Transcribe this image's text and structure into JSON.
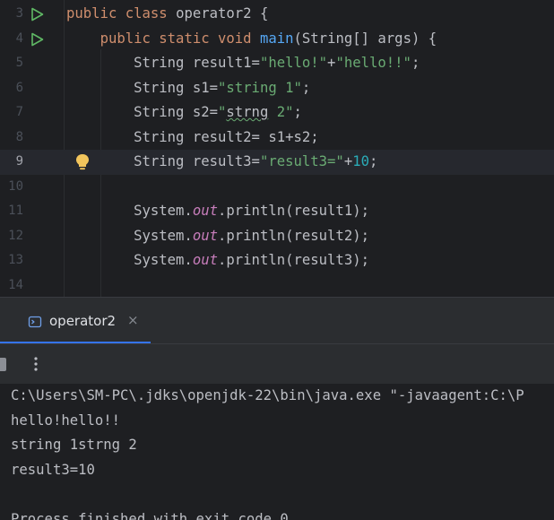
{
  "editor": {
    "lines": [
      {
        "no": "3",
        "tokens": [
          [
            "kw",
            "public class "
          ],
          [
            "plain",
            "operator2 {"
          ]
        ]
      },
      {
        "no": "4",
        "tokens": [
          [
            "plain",
            "    "
          ],
          [
            "kw",
            "public static void "
          ],
          [
            "fn",
            "main"
          ],
          [
            "plain",
            "(String[] args) {"
          ]
        ]
      },
      {
        "no": "5",
        "tokens": [
          [
            "plain",
            "        String result1="
          ],
          [
            "str",
            "\"hello!\""
          ],
          [
            "plain",
            "+"
          ],
          [
            "str",
            "\"hello!!\""
          ],
          [
            "plain",
            ";"
          ]
        ]
      },
      {
        "no": "6",
        "tokens": [
          [
            "plain",
            "        String s1="
          ],
          [
            "str",
            "\"string 1\""
          ],
          [
            "plain",
            ";"
          ]
        ]
      },
      {
        "no": "7",
        "tokens": [
          [
            "plain",
            "        String s2="
          ],
          [
            "str",
            "\""
          ],
          [
            "typo",
            "strng"
          ],
          [
            "str",
            " 2\""
          ],
          [
            "plain",
            ";"
          ]
        ]
      },
      {
        "no": "8",
        "tokens": [
          [
            "plain",
            "        String result2= s1+s2;"
          ]
        ]
      },
      {
        "no": "9",
        "tokens": [
          [
            "plain",
            "        String result3="
          ],
          [
            "str",
            "\"result3=\""
          ],
          [
            "plain",
            "+"
          ],
          [
            "num",
            "10"
          ],
          [
            "plain",
            ";"
          ]
        ]
      },
      {
        "no": "10",
        "tokens": []
      },
      {
        "no": "11",
        "tokens": [
          [
            "plain",
            "        System."
          ],
          [
            "fld",
            "out"
          ],
          [
            "plain",
            ".println(result1);"
          ]
        ]
      },
      {
        "no": "12",
        "tokens": [
          [
            "plain",
            "        System."
          ],
          [
            "fld",
            "out"
          ],
          [
            "plain",
            ".println(result2);"
          ]
        ]
      },
      {
        "no": "13",
        "tokens": [
          [
            "plain",
            "        System."
          ],
          [
            "fld",
            "out"
          ],
          [
            "plain",
            ".println(result3);"
          ]
        ]
      },
      {
        "no": "14",
        "tokens": []
      }
    ],
    "current_line": "9"
  },
  "run_panel": {
    "tab_label": "operator2",
    "close_glyph": "×",
    "more_glyph": "⋮"
  },
  "console": {
    "lines": [
      "C:\\Users\\SM-PC\\.jdks\\openjdk-22\\bin\\java.exe \"-javaagent:C:\\P",
      "hello!hello!!",
      "string 1strng 2",
      "result3=10",
      "",
      "Process finished with exit code 0"
    ]
  },
  "colors": {
    "background": "#1e1f22",
    "keyword": "#cf8e6d",
    "function": "#56a8f5",
    "string": "#6aab73",
    "number": "#2aacb8",
    "field": "#c77dbb",
    "accent": "#3574f0"
  }
}
